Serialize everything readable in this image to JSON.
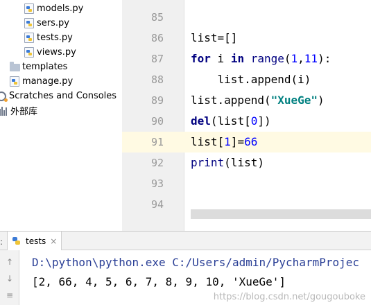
{
  "project_tree": [
    {
      "label": "models.py",
      "kind": "py",
      "indent": 2
    },
    {
      "label": "sers.py",
      "kind": "py",
      "indent": 2
    },
    {
      "label": "tests.py",
      "kind": "py",
      "indent": 2
    },
    {
      "label": "views.py",
      "kind": "py",
      "indent": 2
    },
    {
      "label": "templates",
      "kind": "folder",
      "indent": 1
    },
    {
      "label": "manage.py",
      "kind": "py",
      "indent": 1
    },
    {
      "label": "Scratches and Consoles",
      "kind": "scratch",
      "indent": 0
    },
    {
      "label": "外部库",
      "kind": "libs",
      "indent": 0
    }
  ],
  "editor": {
    "line_numbers": [
      "85",
      "86",
      "87",
      "88",
      "89",
      "90",
      "91",
      "92",
      "93",
      "94"
    ],
    "current_line": "91",
    "code": {
      "l86": "list=[]",
      "l87_for": "for",
      "l87_i": " i ",
      "l87_in": "in",
      "l87_range": " range",
      "l87_open": "(",
      "l87_n1": "1",
      "l87_comma": ",",
      "l87_n2": "11",
      "l87_close": "):",
      "l88": "    list.append(i)",
      "l89_a": "list.append(",
      "l89_str": "\"XueGe\"",
      "l89_b": ")",
      "l90_del": "del",
      "l90_a": "(list[",
      "l90_n": "0",
      "l90_b": "])",
      "l91_a": "list[",
      "l91_n1": "1",
      "l91_b": "]=",
      "l91_n2": "66",
      "l92_print": "print",
      "l92_a": "(list)"
    }
  },
  "run_panel": {
    "side_marker": ":",
    "tab_label": "tests",
    "close_glyph": "×",
    "tools": [
      "↑",
      "↓",
      "≡"
    ],
    "command": "D:\\python\\python.exe C:/Users/admin/PycharmProjec",
    "output": "[2, 66, 4, 5, 6, 7, 8, 9, 10, 'XueGe']",
    "watermark": "https://blog.csdn.net/gougouboke"
  },
  "colors": {
    "keyword": "#000080",
    "number": "#0000ff",
    "string": "#008080",
    "command": "#2a3f96",
    "current_line": "#fffae3"
  }
}
